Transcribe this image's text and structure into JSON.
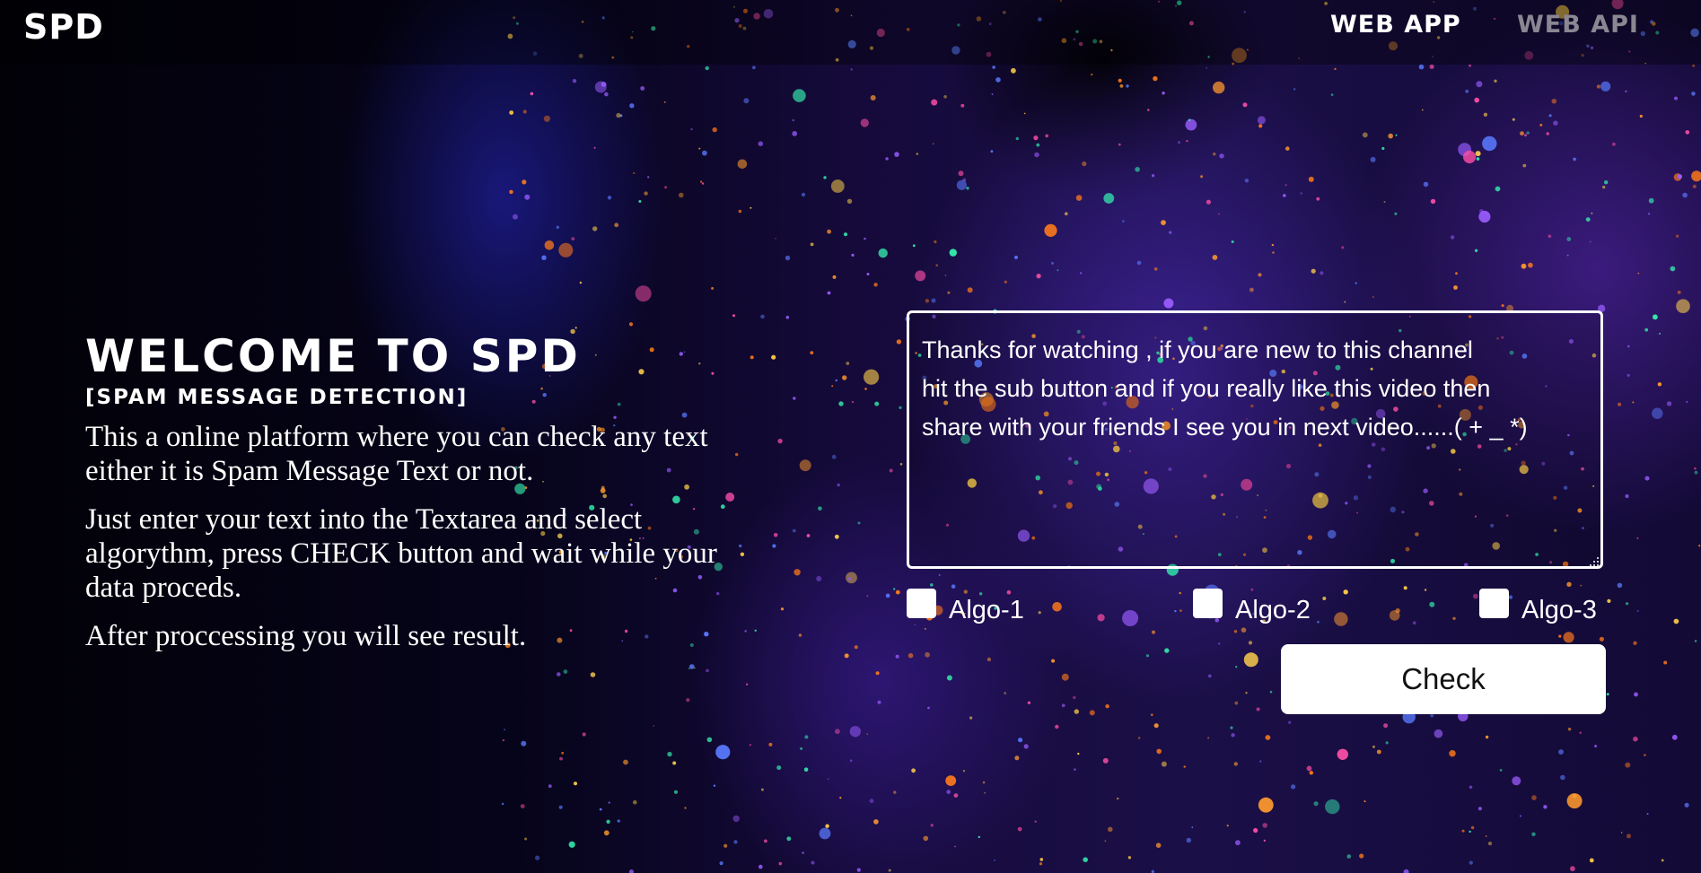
{
  "header": {
    "brand": "SPD",
    "nav": [
      {
        "label": "WEB APP",
        "active": true
      },
      {
        "label": "WEB API",
        "active": false
      }
    ]
  },
  "hero": {
    "title": "WELCOME TO SPD",
    "subtitle": "[SPAM MESSAGE DETECTION]",
    "paragraphs": [
      "This a online platform where you can check any text either it is Spam Message Text or not.",
      "Just enter your text into the Textarea and select algorythm, press CHECK button and wait while your data proceds.",
      "After proccessing you will see result."
    ]
  },
  "form": {
    "message_value": "Thanks for watching , if you are new to this channel\nhit the sub button and if you really like this video then\nshare with your friends I see you in next video......( + _ *)",
    "algorithms": [
      {
        "label": "Algo-1",
        "checked": false
      },
      {
        "label": "Algo-2",
        "checked": false
      },
      {
        "label": "Algo-3",
        "checked": false
      }
    ],
    "submit_label": "Check"
  },
  "colors": {
    "text": "#ffffff",
    "nav_inactive": "#8a8792",
    "button_bg": "#ffffff",
    "button_text": "#111111"
  }
}
